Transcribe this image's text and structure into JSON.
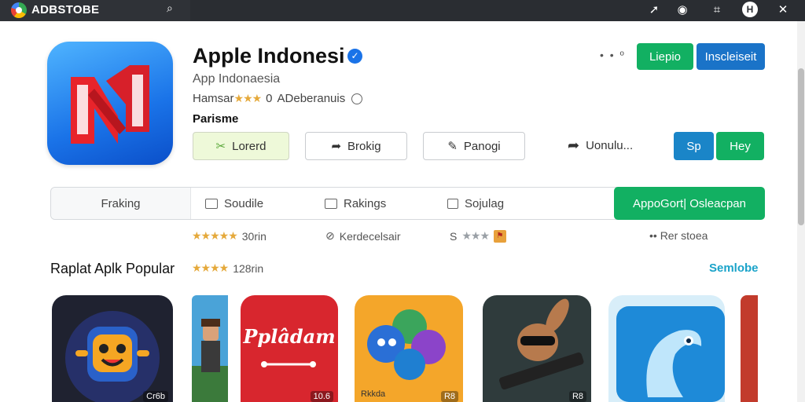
{
  "topbar": {
    "brand": "ADBSTOBE",
    "icons": [
      "search-icon",
      "pin-icon",
      "record-icon",
      "hash-icon",
      "user-icon",
      "close-icon"
    ],
    "avatar_letter": "H"
  },
  "app": {
    "title": "Apple Indonesi",
    "subtitle": "App Indonaesia",
    "rating_prefix": "Hamsar",
    "rating_stars": "★★★",
    "rating_count": "0",
    "rating_suffix": "ADeberanuis",
    "developer": "Parisme",
    "more": "• • º"
  },
  "header_buttons": {
    "primary": "Liepio",
    "secondary": "Inscleiseit"
  },
  "actions": {
    "lorerd": "Lorerd",
    "brokig": "Brokig",
    "panogi": "Panogi",
    "share": "Uonulu...",
    "sp": "Sp",
    "hey": "Hey"
  },
  "tabs": {
    "items": [
      "Fraking",
      "Soudile",
      "Rakings",
      "Sojulag"
    ],
    "cta": "AppoGort| Osleacpan"
  },
  "stats": {
    "rating_stars": "★★★★★",
    "rating_value": "30rin",
    "developer": "Kerdecelsair",
    "grey_stars_prefix": "S",
    "grey_stars": "★★★",
    "extra": "•• Rer stoea"
  },
  "section": {
    "title": "Raplat Aplk Popular",
    "stars": "★★★★",
    "count": "128rin",
    "see_more": "Semlobe"
  },
  "cards": [
    {
      "name": "robot-app",
      "price": "Cr6b"
    },
    {
      "name": "game-character-app",
      "price": ""
    },
    {
      "name": "pplodam-app",
      "price": "10.6"
    },
    {
      "name": "chat-bubbles-app",
      "price": "R8"
    },
    {
      "name": "rabbit-guitar-app",
      "price": "R8"
    },
    {
      "name": "blue-bird-app",
      "price": ""
    },
    {
      "name": "partial-app",
      "price": ""
    }
  ],
  "cards_text": {
    "pplodam": "Pplâdam",
    "bubbles": "Rkkda"
  },
  "colors": {
    "accent_green": "#12b062",
    "accent_blue": "#1a73c8",
    "link": "#1aa3c9",
    "topbar": "#2a2d32"
  }
}
